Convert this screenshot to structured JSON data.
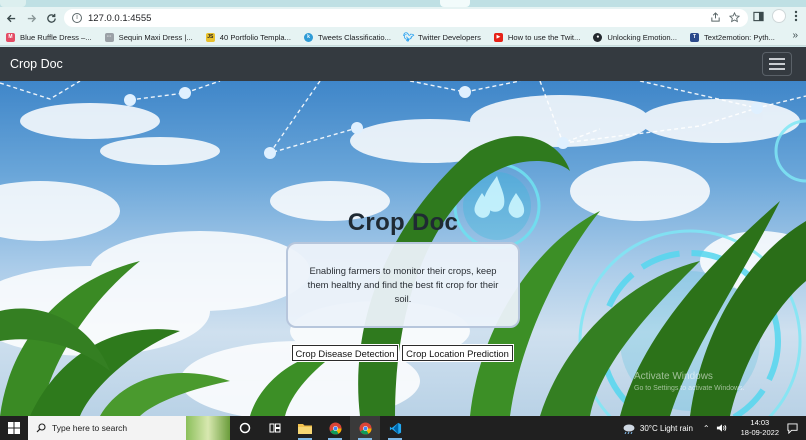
{
  "browser": {
    "url": "127.0.0.1:4555",
    "bookmarks": [
      {
        "label": "Blue Ruffle Dress –...",
        "icon": "myntra-icon",
        "color": "#e44c65"
      },
      {
        "label": "Sequin Maxi Dress |...",
        "icon": "dots-icon",
        "color": "#9aa0a6"
      },
      {
        "label": "40 Portfolio Templa...",
        "icon": "js-icon",
        "color": "#e8c12d"
      },
      {
        "label": "Tweets Classificatio...",
        "icon": "kaggle-icon",
        "color": "#2e9bd6"
      },
      {
        "label": "Twitter Developers",
        "icon": "twitter-icon",
        "color": "#1d9bf0"
      },
      {
        "label": "How to use the Twit...",
        "icon": "youtube-icon",
        "color": "#e62117"
      },
      {
        "label": "Unlocking Emotion...",
        "icon": "github-icon",
        "color": "#24292e"
      },
      {
        "label": "Text2emotion: Pyth...",
        "icon": "tds-icon",
        "color": "#2b4a8b"
      }
    ]
  },
  "navbar": {
    "brand": "Crop Doc"
  },
  "hero": {
    "title": "Crop Doc",
    "description": "Enabling farmers to monitor their crops, keep them healthy and find the best fit crop for their soil.",
    "buttons": {
      "disease": "Crop Disease Detection",
      "location": "Crop Location Prediction"
    }
  },
  "watermark": {
    "line1": "Activate Windows",
    "line2": "Go to Settings to activate Windows."
  },
  "taskbar": {
    "search_placeholder": "Type here to search",
    "weather": "30°C  Light rain",
    "time": "14:03",
    "date": "18-09-2022"
  },
  "colors": {
    "navbar": "#343a40",
    "taskbar": "#202020",
    "accent": "#2f9fd0"
  }
}
